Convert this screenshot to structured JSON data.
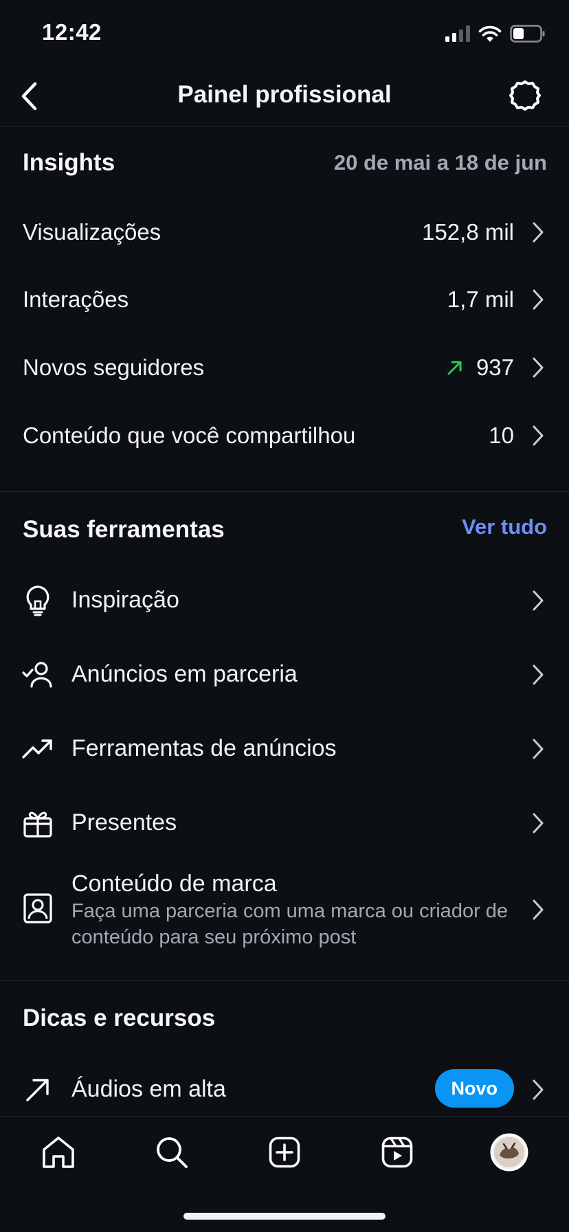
{
  "status_bar": {
    "time": "12:42"
  },
  "header": {
    "title": "Painel profissional",
    "back_icon": "chevron-left-icon",
    "settings_icon": "gear-icon"
  },
  "insights": {
    "title": "Insights",
    "date_range": "20 de mai a 18 de jun",
    "rows": [
      {
        "label": "Visualizações",
        "value": "152,8 mil"
      },
      {
        "label": "Interações",
        "value": "1,7 mil"
      },
      {
        "label": "Novos seguidores",
        "value": "937",
        "trend": "up",
        "trend_color": "#34c759"
      },
      {
        "label": "Conteúdo que você compartilhou",
        "value": "10"
      }
    ]
  },
  "tools": {
    "title": "Suas ferramentas",
    "see_all": "Ver tudo",
    "items": [
      {
        "label": "Inspiração",
        "icon": "lightbulb-icon"
      },
      {
        "label": "Anúncios em parceria",
        "icon": "partner-user-check-icon"
      },
      {
        "label": "Ferramentas de anúncios",
        "icon": "trending-up-icon"
      },
      {
        "label": "Presentes",
        "icon": "gift-icon"
      },
      {
        "label": "Conteúdo de marca",
        "sub": "Faça uma parceria com uma marca ou criador de conteúdo para seu próximo post",
        "icon": "branded-content-icon"
      }
    ]
  },
  "tips": {
    "title": "Dicas e recursos",
    "items": [
      {
        "label": "Áudios em alta",
        "badge": "Novo",
        "icon": "arrow-up-right-icon"
      }
    ]
  },
  "tabbar": {
    "items": [
      "home-icon",
      "search-icon",
      "create-plus-icon",
      "reels-icon",
      "profile-avatar"
    ]
  },
  "colors": {
    "background": "#0c0f14",
    "accent_link": "#6e8ef7",
    "badge": "#0a95f5",
    "trend_up": "#34c759"
  }
}
